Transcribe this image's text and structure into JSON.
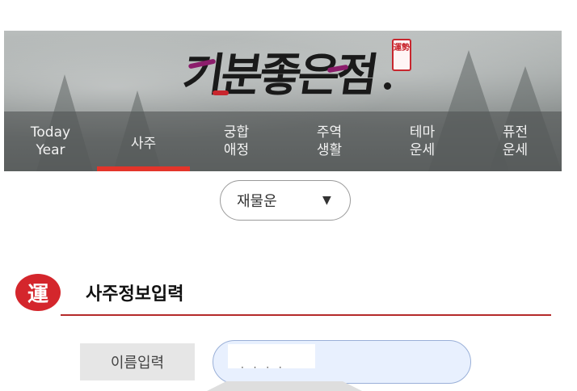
{
  "header": {
    "logo_text": "기분좋은점",
    "logo_seal": "運勢"
  },
  "nav": {
    "items": [
      {
        "line1": "Today",
        "line2": "Year",
        "active": false
      },
      {
        "line1": "사주",
        "line2": "",
        "active": true
      },
      {
        "line1": "궁합",
        "line2": "애정",
        "active": false
      },
      {
        "line1": "주역",
        "line2": "생활",
        "active": false
      },
      {
        "line1": "테마",
        "line2": "운세",
        "active": false
      },
      {
        "line1": "퓨전",
        "line2": "운세",
        "active": false
      }
    ],
    "active_color": "#e3342a"
  },
  "fortune_select": {
    "selected": "재물운",
    "arrow": "▼"
  },
  "section": {
    "icon_char": "運",
    "title": "사주정보입력",
    "accent_color": "#d4262c"
  },
  "form": {
    "name_label": "이름입력",
    "name_value": "· · · ·"
  }
}
